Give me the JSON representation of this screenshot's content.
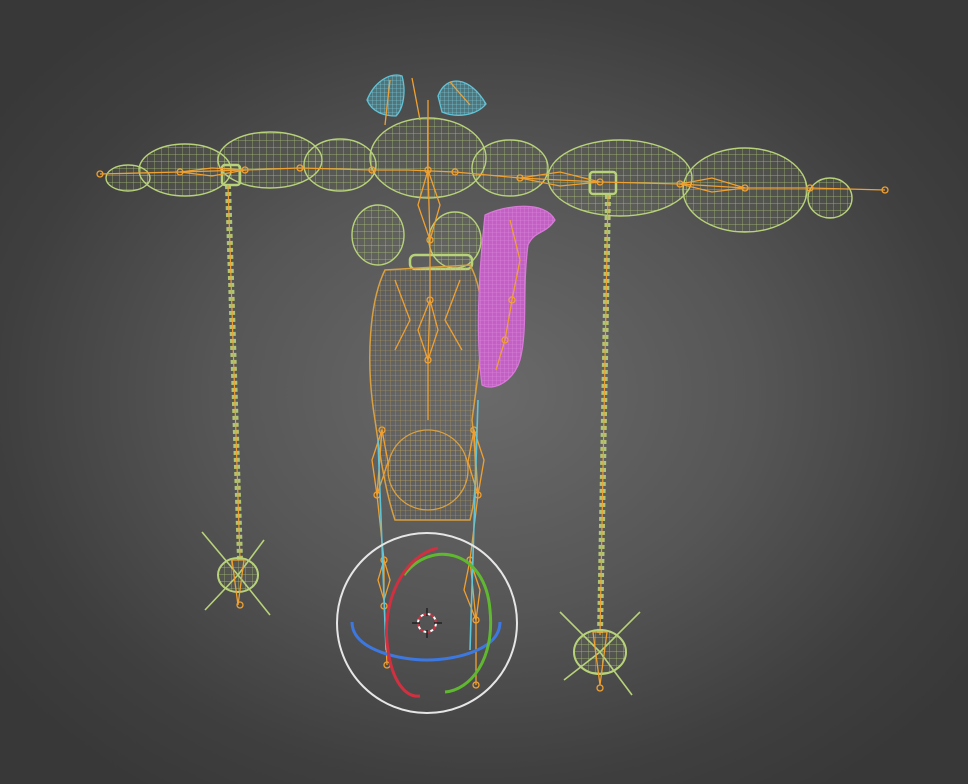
{
  "viewport": {
    "shading": "wireframe",
    "colors": {
      "background_center": "#6a6a6a",
      "background_edge": "#383838",
      "mesh_wire": "#b8d27a",
      "armature": "#f0a030",
      "hair_bones": "#5fc4d8",
      "tail": "#cc66cc",
      "gizmo_x": "#d03040",
      "gizmo_y": "#60b830",
      "gizmo_z": "#3d78e0",
      "gizmo_view": "#e6e6e6",
      "cursor": "#ffffff"
    },
    "model": {
      "pose": "T-pose",
      "parts": [
        "head",
        "hair-tufts",
        "torso",
        "left-arm",
        "right-arm",
        "left-chain",
        "right-chain",
        "left-spike-weight",
        "right-spike-weight",
        "tail",
        "legs"
      ]
    },
    "gizmo": {
      "type": "rotate",
      "axes": [
        "x",
        "y",
        "z",
        "view"
      ]
    },
    "icons": [
      "3d-cursor-icon",
      "rotate-gizmo-icon"
    ]
  }
}
